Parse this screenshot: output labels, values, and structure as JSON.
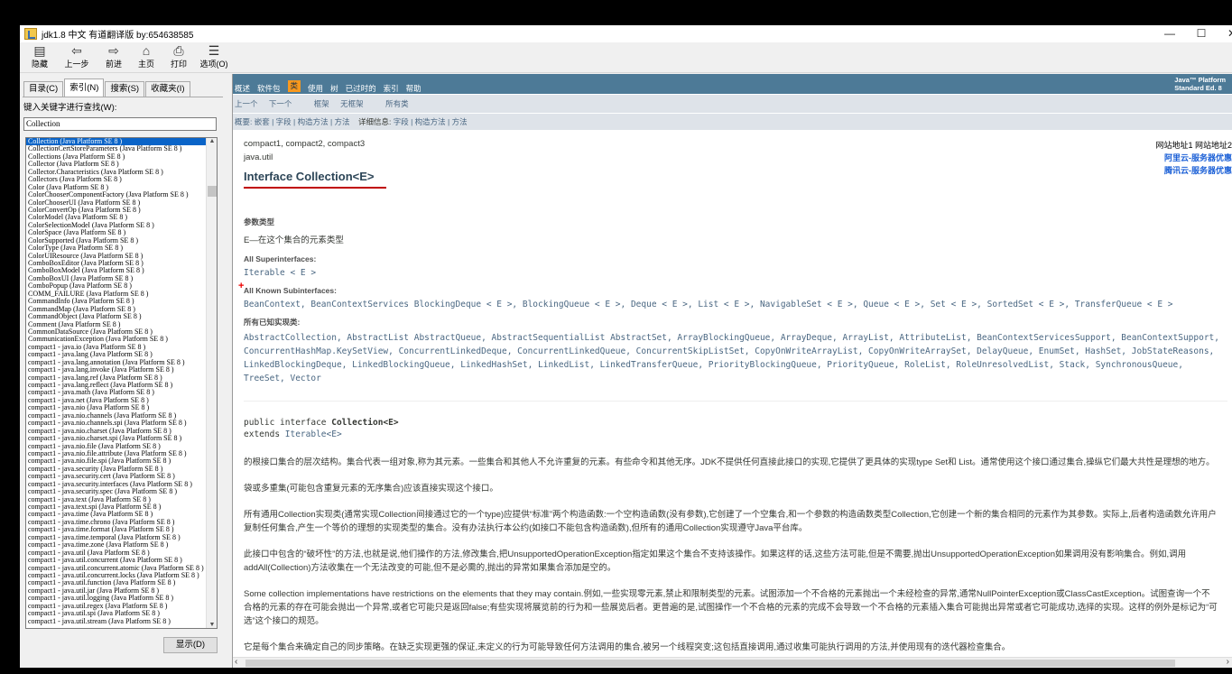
{
  "window": {
    "title": "jdk1.8 中文 有道翻译版 by:654638585",
    "min": "—",
    "max": "☐",
    "close": "✕"
  },
  "toolbar": {
    "hide": "隐藏",
    "back": "上一步",
    "forward": "前进",
    "home": "主页",
    "print": "打印",
    "options": "选项(O)"
  },
  "left": {
    "tabs": [
      "目录(C)",
      "索引(N)",
      "搜索(S)",
      "收藏夹(I)"
    ],
    "active_tab": 1,
    "search_label": "键入关键字进行查找(W):",
    "search_value": "Collection",
    "show_button": "显示(D)",
    "index_items": [
      "Collection (Java Platform SE 8 )",
      "CollectionCertStoreParameters (Java Platform SE 8 )",
      "Collections (Java Platform SE 8 )",
      "Collector (Java Platform SE 8 )",
      "Collector.Characteristics (Java Platform SE 8 )",
      "Collectors (Java Platform SE 8 )",
      "Color (Java Platform SE 8 )",
      "ColorChooserComponentFactory (Java Platform SE 8 )",
      "ColorChooserUI (Java Platform SE 8 )",
      "ColorConvertOp (Java Platform SE 8 )",
      "ColorModel (Java Platform SE 8 )",
      "ColorSelectionModel (Java Platform SE 8 )",
      "ColorSpace (Java Platform SE 8 )",
      "ColorSupported (Java Platform SE 8 )",
      "ColorType (Java Platform SE 8 )",
      "ColorUIResource (Java Platform SE 8 )",
      "ComboBoxEditor (Java Platform SE 8 )",
      "ComboBoxModel (Java Platform SE 8 )",
      "ComboBoxUI (Java Platform SE 8 )",
      "ComboPopup (Java Platform SE 8 )",
      "COMM_FAILURE (Java Platform SE 8 )",
      "CommandInfo (Java Platform SE 8 )",
      "CommandMap (Java Platform SE 8 )",
      "CommandObject (Java Platform SE 8 )",
      "Comment (Java Platform SE 8 )",
      "CommonDataSource (Java Platform SE 8 )",
      "CommunicationException (Java Platform SE 8 )",
      "compact1 - java.io (Java Platform SE 8 )",
      "compact1 - java.lang (Java Platform SE 8 )",
      "compact1 - java.lang.annotation (Java Platform SE 8 )",
      "compact1 - java.lang.invoke (Java Platform SE 8 )",
      "compact1 - java.lang.ref (Java Platform SE 8 )",
      "compact1 - java.lang.reflect (Java Platform SE 8 )",
      "compact1 - java.math (Java Platform SE 8 )",
      "compact1 - java.net (Java Platform SE 8 )",
      "compact1 - java.nio (Java Platform SE 8 )",
      "compact1 - java.nio.channels (Java Platform SE 8 )",
      "compact1 - java.nio.channels.spi (Java Platform SE 8 )",
      "compact1 - java.nio.charset (Java Platform SE 8 )",
      "compact1 - java.nio.charset.spi (Java Platform SE 8 )",
      "compact1 - java.nio.file (Java Platform SE 8 )",
      "compact1 - java.nio.file.attribute (Java Platform SE 8 )",
      "compact1 - java.nio.file.spi (Java Platform SE 8 )",
      "compact1 - java.security (Java Platform SE 8 )",
      "compact1 - java.security.cert (Java Platform SE 8 )",
      "compact1 - java.security.interfaces (Java Platform SE 8 )",
      "compact1 - java.security.spec (Java Platform SE 8 )",
      "compact1 - java.text (Java Platform SE 8 )",
      "compact1 - java.text.spi (Java Platform SE 8 )",
      "compact1 - java.time (Java Platform SE 8 )",
      "compact1 - java.time.chrono (Java Platform SE 8 )",
      "compact1 - java.time.format (Java Platform SE 8 )",
      "compact1 - java.time.temporal (Java Platform SE 8 )",
      "compact1 - java.time.zone (Java Platform SE 8 )",
      "compact1 - java.util (Java Platform SE 8 )",
      "compact1 - java.util.concurrent (Java Platform SE 8 )",
      "compact1 - java.util.concurrent.atomic (Java Platform SE 8 )",
      "compact1 - java.util.concurrent.locks (Java Platform SE 8 )",
      "compact1 - java.util.function (Java Platform SE 8 )",
      "compact1 - java.util.jar (Java Platform SE 8 )",
      "compact1 - java.util.logging (Java Platform SE 8 )",
      "compact1 - java.util.regex (Java Platform SE 8 )",
      "compact1 - java.util.spi (Java Platform SE 8 )",
      "compact1 - java.util.stream (Java Platform SE 8 )"
    ]
  },
  "nav": {
    "links": [
      "概述",
      "软件包",
      "类",
      "使用",
      "树",
      "已过时的",
      "索引",
      "帮助"
    ],
    "current": "类",
    "platform_line1": "Java™ Platform",
    "platform_line2": "Standard Ed. 8",
    "sub1": [
      "上一个",
      "下一个",
      "框架",
      "无框架",
      "所有类"
    ],
    "sub2_summary": "概要: 嵌套 | 字段 | 构造方法 | 方法",
    "sub2_detail_label": "详细信息:",
    "sub2_detail": "字段 | 构造方法 | 方法"
  },
  "doc": {
    "modules": "compact1, compact2, compact3",
    "package": "java.util",
    "title": "Interface Collection<E>",
    "type_params_label": "参数类型",
    "type_params_value": "E—在这个集合的元素类型",
    "super_label": "All Superinterfaces:",
    "super_value": "Iterable < E >",
    "sub_label": "All Known Subinterfaces:",
    "sub_value": "BeanContext,  BeanContextServices BlockingDeque < E >, BlockingQueue < E >, Deque < E >, List < E >, NavigableSet < E >, Queue < E >, Set < E >, SortedSet < E >, TransferQueue < E >",
    "impl_label": "所有已知实现类:",
    "impl_value": "AbstractCollection,  AbstractList AbstractQueue,  AbstractSequentialList AbstractSet, ArrayBlockingQueue, ArrayDeque, ArrayList, AttributeList, BeanContextServicesSupport, BeanContextSupport, ConcurrentHashMap.KeySetView, ConcurrentLinkedDeque, ConcurrentLinkedQueue, ConcurrentSkipListSet, CopyOnWriteArrayList, CopyOnWriteArraySet, DelayQueue, EnumSet, HashSet, JobStateReasons, LinkedBlockingDeque, LinkedBlockingQueue, LinkedHashSet, LinkedList, LinkedTransferQueue, PriorityBlockingQueue, PriorityQueue, RoleList, RoleUnresolvedList, Stack, SynchronousQueue, TreeSet, Vector",
    "decl_prefix": "public interface ",
    "decl_name": "Collection<E>",
    "decl_extends_kw": "extends ",
    "decl_extends": "Iterable<E>",
    "p1": "的根接口集合的层次结构。集合代表一组对象,称为其元素。一些集合和其他人不允许重复的元素。有些命令和其他无序。JDK不提供任何直接此接口的实现,它提供了更具体的实现type Set和 List。通常使用这个接口通过集合,操纵它们最大共性是理想的地方。",
    "p2": "袋或多重集(可能包含重复元素的无序集合)应该直接实现这个接口。",
    "p3": "所有通用Collection实现类(通常实现Collection间接通过它的一个type)应提供“标准”两个构造函数:一个空构造函数(没有参数),它创建了一个空集合,和一个参数的构造函数类型Collection,它创建一个新的集合相同的元素作为其参数。实际上,后者构造函数允许用户复制任何集合,产生一个等价的理想的实现类型的集合。没有办法执行本公约(如接口不能包含构造函数),但所有的通用Collection实现遵守Java平台库。",
    "p4": "此接口中包含的“破坏性”的方法,也就是说,他们操作的方法,修改集合,把UnsupportedOperationException指定如果这个集合不支持该操作。如果这样的话,这些方法可能,但是不需要,抛出UnsupportedOperationException如果调用没有影响集合。例如,调用addAll(Collection)方法收集在一个无法改变的可能,但不是必需的,抛出的异常如果集合添加是空的。",
    "p5": "Some collection implementations have restrictions on the elements that they may contain.例如,一些实现零元素,禁止和限制类型的元素。试图添加一个不合格的元素抛出一个未经检查的异常,通常NullPointerException或ClassCastException。试图查询一个不合格的元素的存在可能会抛出一个异常,或者它可能只是返回false;有些实现将展览前的行为和一些展览后者。更普遍的是,试图操作一个不合格的元素的完成不会导致一个不合格的元素插入集合可能抛出异常或者它可能成功,选择的实现。这样的例外是标记为“可选”这个接口的规范。",
    "p6": "它是每个集合来确定自己的同步策略。在缺乏实现更强的保证,未定义的行为可能导致任何方法调用的集合,被另一个线程突变;这包括直接调用,通过收集可能执行调用的方法,并使用现有的迭代器检查集合。"
  },
  "ads": {
    "line1": "网站地址1 网站地址2",
    "aliyun": "阿里云-服务器优惠",
    "tencent": "腾讯云-服务器优惠"
  }
}
